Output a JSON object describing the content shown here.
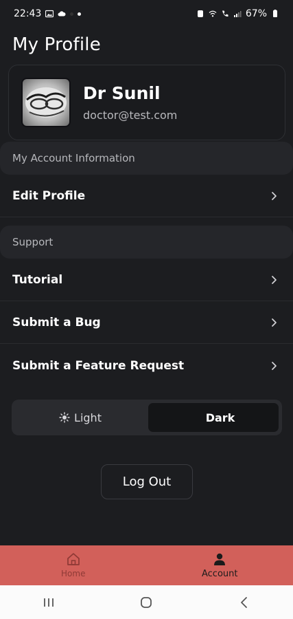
{
  "status_bar": {
    "time": "22:43",
    "battery": "67%"
  },
  "page": {
    "title": "My Profile"
  },
  "profile": {
    "name": "Dr Sunil",
    "email": "doctor@test.com"
  },
  "sections": {
    "account_header": "My Account Information",
    "support_header": "Support"
  },
  "menu": {
    "edit_profile": "Edit Profile",
    "tutorial": "Tutorial",
    "submit_bug": "Submit a Bug",
    "submit_feature": "Submit a Feature Request"
  },
  "theme": {
    "light_label": "Light",
    "dark_label": "Dark",
    "selected": "Dark"
  },
  "actions": {
    "logout_label": "Log Out"
  },
  "bottom_nav": {
    "home_label": "Home",
    "account_label": "Account",
    "active": "Account",
    "color": "#d2605a"
  },
  "colors": {
    "background": "#1c1d20",
    "section_bg": "#25262a"
  }
}
